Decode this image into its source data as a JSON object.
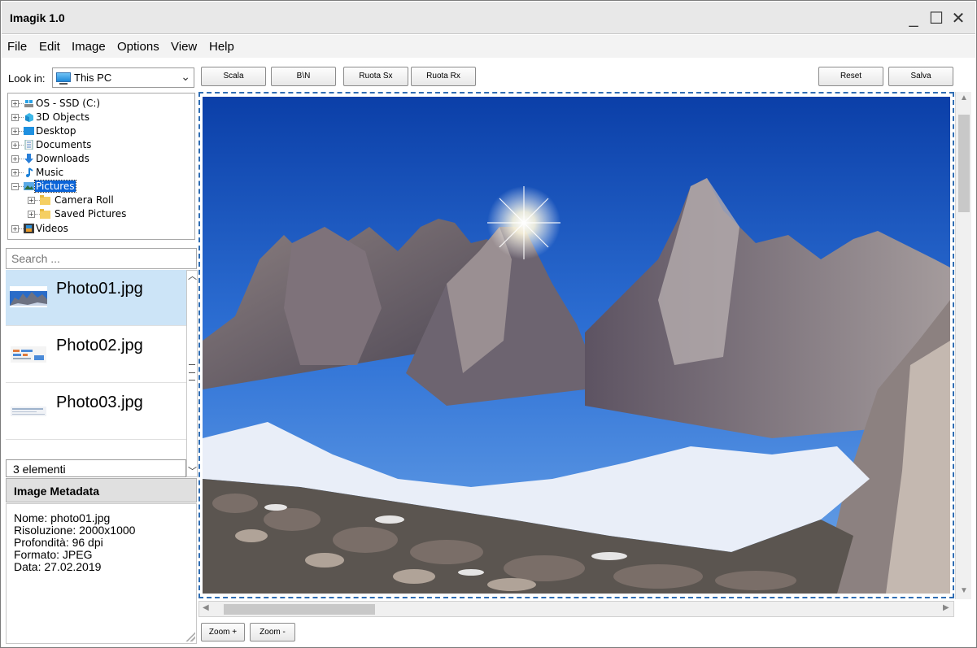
{
  "app": {
    "title": "Imagik 1.0"
  },
  "window_controls": {
    "minimize": "_",
    "maximize": "☐",
    "close": "✕"
  },
  "menu": [
    "File",
    "Edit",
    "Image",
    "Options",
    "View",
    "Help"
  ],
  "lookin": {
    "label": "Look in:",
    "value": "This PC",
    "icon": "computer-icon"
  },
  "toolbar": {
    "scala": "Scala",
    "bn": "B\\N",
    "ruota_sx": "Ruota Sx",
    "ruota_rx": "Ruota Rx",
    "reset": "Reset",
    "salva": "Salva"
  },
  "tree": [
    {
      "label": "OS - SSD (C:)",
      "icon": "drive-icon",
      "expand": "+",
      "selected": false
    },
    {
      "label": "3D Objects",
      "icon": "cube-icon",
      "expand": "+",
      "selected": false
    },
    {
      "label": "Desktop",
      "icon": "desktop-icon",
      "expand": "+",
      "selected": false
    },
    {
      "label": "Documents",
      "icon": "document-icon",
      "expand": "+",
      "selected": false
    },
    {
      "label": "Downloads",
      "icon": "download-icon",
      "expand": "+",
      "selected": false
    },
    {
      "label": "Music",
      "icon": "music-icon",
      "expand": "+",
      "selected": false
    },
    {
      "label": "Pictures",
      "icon": "pictures-icon",
      "expand": "−",
      "selected": true
    },
    {
      "label": "Camera Roll",
      "icon": "folder-icon",
      "expand": "+",
      "selected": false
    },
    {
      "label": "Saved Pictures",
      "icon": "folder-icon",
      "expand": "+",
      "selected": false
    },
    {
      "label": "Videos",
      "icon": "video-icon",
      "expand": "+",
      "selected": false
    }
  ],
  "search": {
    "placeholder": "Search ..."
  },
  "files": [
    {
      "name": "Photo01.jpg",
      "selected": true
    },
    {
      "name": "Photo02.jpg",
      "selected": false
    },
    {
      "name": "Photo03.jpg",
      "selected": false
    }
  ],
  "files_count": "3 elementi",
  "metadata": {
    "header": "Image Metadata",
    "lines": [
      "Nome: photo01.jpg",
      "Risoluzione: 2000x1000",
      "Profondità: 96 dpi",
      "Formato: JPEG",
      "Data: 27.02.2019"
    ]
  },
  "zoom": {
    "in": "Zoom +",
    "out": "Zoom -"
  },
  "colors": {
    "selection": "#0a64d8",
    "list_selection": "#cce4f7",
    "viewer_border": "#2f6db3"
  }
}
